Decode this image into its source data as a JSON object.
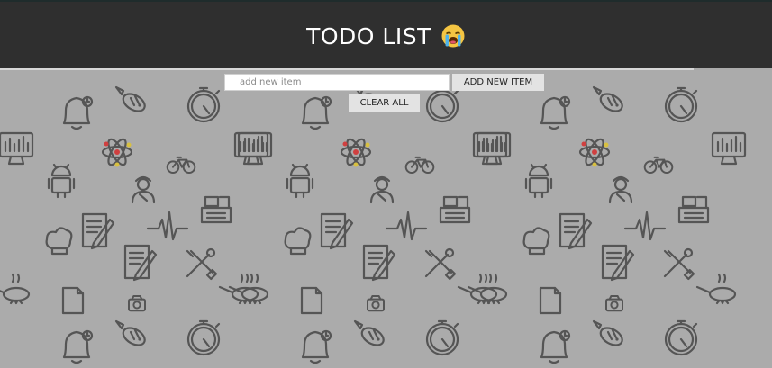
{
  "header": {
    "title": "TODO LIST",
    "emoji_icon": "loudly-crying-face-icon",
    "background": "#2f2f2f"
  },
  "form": {
    "input_placeholder": "add new item",
    "input_value": "",
    "add_button_label": "ADD NEW ITEM",
    "clear_button_label": "CLEAR ALL"
  },
  "background": {
    "color": "#ababab",
    "icon_color": "#555555",
    "pattern_icons": [
      "bell-icon",
      "fish-icon",
      "stopwatch-icon",
      "chart-monitor-icon",
      "atom-icon",
      "bicycle-icon",
      "android-icon",
      "worker-icon",
      "cash-register-icon",
      "document-pencil-icon",
      "heartbeat-icon",
      "chef-hat-icon",
      "tools-icon",
      "frying-pan-icon",
      "js-file-icon",
      "camera-icon",
      "fire-icon"
    ]
  }
}
